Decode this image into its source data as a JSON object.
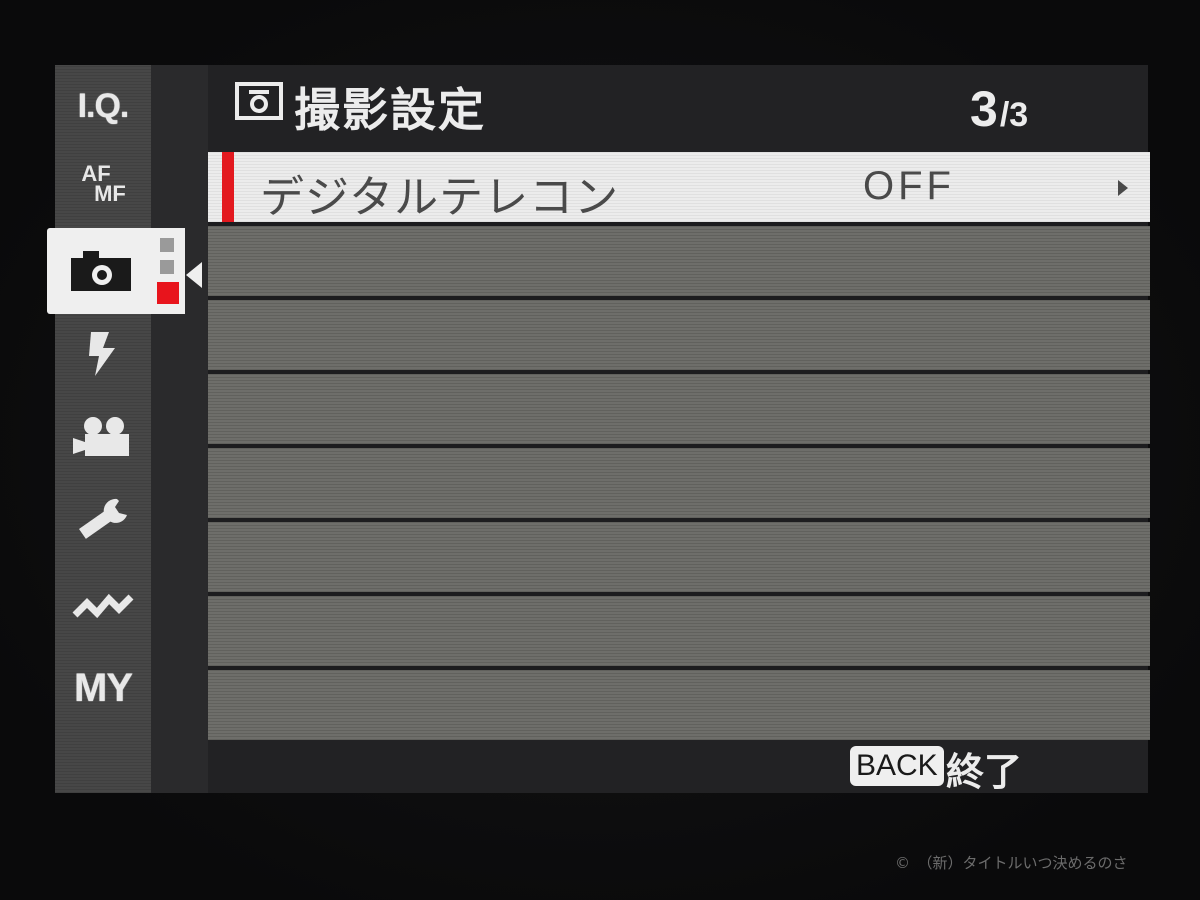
{
  "sidebar": {
    "categories": [
      {
        "id": "iq",
        "label": "I.Q."
      },
      {
        "id": "afmf",
        "label_top": "AF",
        "label_bottom": "MF"
      },
      {
        "id": "shooting",
        "icon": "camera-icon"
      },
      {
        "id": "flash",
        "icon": "flash-icon"
      },
      {
        "id": "movie",
        "icon": "movie-camera-icon"
      },
      {
        "id": "setup",
        "icon": "wrench-icon"
      },
      {
        "id": "connection",
        "icon": "connection-icon"
      },
      {
        "id": "my",
        "label": "MY"
      }
    ],
    "active": "shooting",
    "active_subpage": 3,
    "subpages_total": 3
  },
  "header": {
    "icon": "camera-icon",
    "title": "撮影設定",
    "page_current": "3",
    "page_total": "/3"
  },
  "menu": {
    "items": [
      {
        "label": "デジタルテレコン",
        "value": "OFF",
        "selected": true
      }
    ],
    "empty_rows": 7
  },
  "footer": {
    "back_key": "BACK",
    "back_action": "終了"
  },
  "watermark": "©　（新）タイトルいつ決めるのさ",
  "colors": {
    "accent": "#e3191f",
    "selected_row": "#ececec",
    "row": "#6e6e6a"
  }
}
